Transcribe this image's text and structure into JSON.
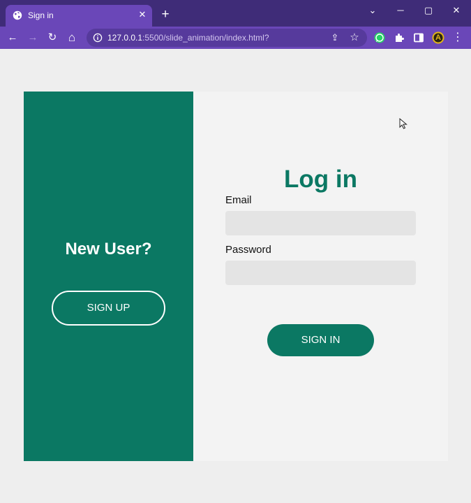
{
  "browser": {
    "tab": {
      "title": "Sign in",
      "close_glyph": "✕"
    },
    "new_tab_glyph": "+",
    "window_controls": {
      "tab_search": "⌄",
      "minimize": "─",
      "maximize": "▢",
      "close": "✕"
    },
    "toolbar": {
      "back": "←",
      "forward": "→",
      "reload": "↻",
      "home": "⌂",
      "url_host": "127.0.0.1",
      "url_rest": ":5500/slide_animation/index.html?",
      "share": "⇪",
      "bookmark": "☆",
      "profile_initial": "A",
      "menu": "⋮"
    },
    "colors": {
      "frame": "#3f2c78",
      "toolbar": "#6a47b8",
      "omnibox": "#563a9c"
    }
  },
  "page": {
    "left_panel": {
      "heading": "New User?",
      "signup_label": "SIGN UP"
    },
    "login": {
      "title": "Log in",
      "email_label": "Email",
      "email_value": "",
      "password_label": "Password",
      "password_value": "",
      "signin_label": "SIGN IN"
    },
    "colors": {
      "accent": "#0b7863",
      "background": "#eeeeee",
      "card": "#f3f3f3",
      "input": "#e4e4e4"
    }
  }
}
